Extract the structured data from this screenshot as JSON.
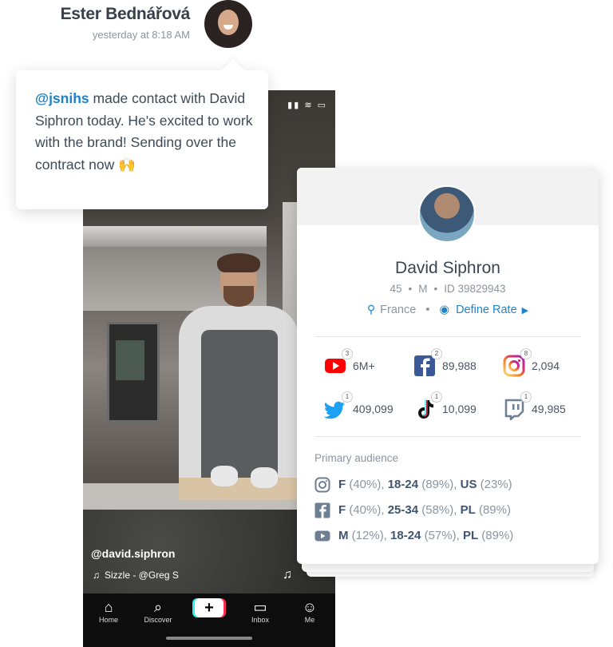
{
  "sender": {
    "name": "Ester Bednářová",
    "time": "yesterday at 8:18 AM"
  },
  "message": {
    "mention": "@jsnihs",
    "text": " made contact with David Siphron today. He's excited to work with the brand! Sending over the contract now 🙌"
  },
  "video": {
    "handle": "@david.siphron",
    "song": "Sizzle - @Greg S",
    "nav": [
      {
        "label": "Home",
        "icon": "home-icon"
      },
      {
        "label": "Discover",
        "icon": "search-icon"
      },
      {
        "label": "Inbox",
        "icon": "inbox-icon"
      },
      {
        "label": "Me",
        "icon": "user-icon"
      }
    ]
  },
  "profile": {
    "name": "David Siphron",
    "age": "45",
    "gender": "M",
    "id": "ID 39829943",
    "location": "France",
    "rate_label": "Define Rate",
    "stats": [
      {
        "platform": "youtube",
        "count": "3",
        "value": "6M+",
        "color": "#ff0000"
      },
      {
        "platform": "facebook",
        "count": "2",
        "value": "89,988",
        "color": "#3b5998"
      },
      {
        "platform": "instagram",
        "count": "8",
        "value": "2,094",
        "color": "#d62976"
      },
      {
        "platform": "twitter",
        "count": "1",
        "value": "409,099",
        "color": "#1da1f2"
      },
      {
        "platform": "tiktok",
        "count": "1",
        "value": "10,099",
        "color": "#000000"
      },
      {
        "platform": "twitch",
        "count": "1",
        "value": "49,985",
        "color": "#6e7f94"
      }
    ],
    "audience_title": "Primary audience",
    "audience": [
      {
        "platform": "instagram",
        "g": "F",
        "gp": "(40%),",
        "age": "18-24",
        "ap": "(89%),",
        "c": "US",
        "cp": "(23%)"
      },
      {
        "platform": "facebook",
        "g": "F",
        "gp": "(40%),",
        "age": "25-34",
        "ap": "(58%),",
        "c": "PL",
        "cp": "(89%)"
      },
      {
        "platform": "youtube",
        "g": "M",
        "gp": "(12%),",
        "age": "18-24",
        "ap": "(57%),",
        "c": "PL",
        "cp": "(89%)"
      }
    ]
  }
}
